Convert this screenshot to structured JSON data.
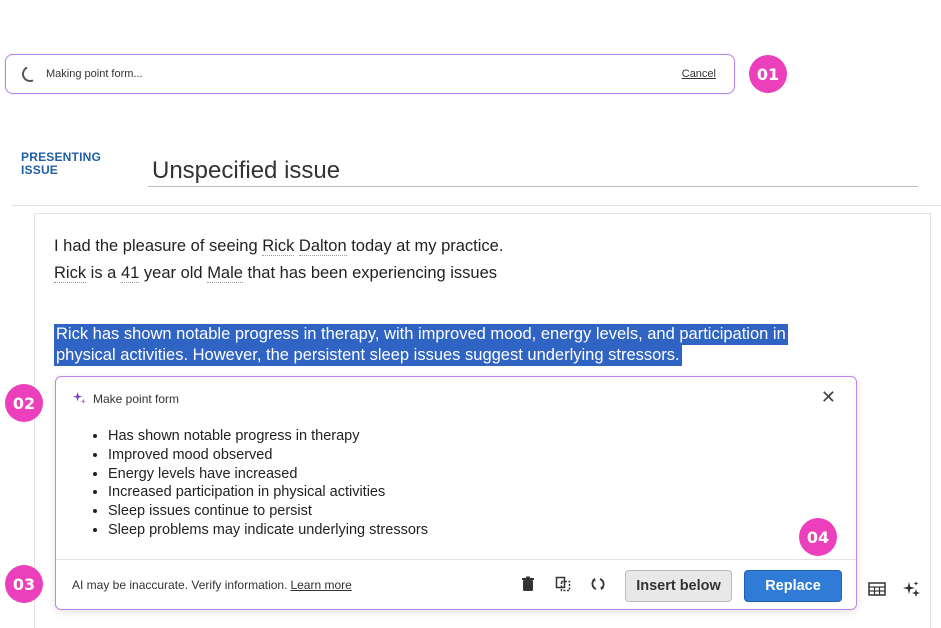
{
  "status_bar": {
    "text": "Making point form...",
    "cancel_label": "Cancel"
  },
  "steps": {
    "s1": "01",
    "s2": "02",
    "s3": "03",
    "s4": "04"
  },
  "presenting_issue": {
    "label": "PRESENTING\nISSUE",
    "value": "Unspecified issue"
  },
  "editor": {
    "line1": {
      "prefix": "I had the pleasure of seeing ",
      "first_name": "Rick",
      "last_name": "Dalton",
      "suffix": " today at my practice."
    },
    "line2": {
      "name": "Rick",
      "mid1": " is a ",
      "age": "41",
      "mid2": " year old ",
      "gender": "Male",
      "suffix": " that has been experiencing issues"
    },
    "selected_line1": "Rick has shown notable progress in therapy, with improved mood, energy levels, and participation in",
    "selected_line2": "physical activities. However, the persistent sleep issues suggest underlying stressors."
  },
  "popup": {
    "title": "Make point form",
    "bullets": [
      "Has shown notable progress in therapy",
      "Improved mood observed",
      "Energy levels have increased",
      "Increased participation in physical activities",
      "Sleep issues continue to persist",
      "Sleep problems may indicate underlying stressors"
    ],
    "disclaimer": "AI may be inaccurate. Verify information.",
    "learn_more": "Learn more",
    "insert_below_label": "Insert below",
    "replace_label": "Replace"
  },
  "colors": {
    "accent_pink": "#ec3fbb",
    "primary_blue": "#2f7bd6",
    "highlight": "#2f63c4",
    "popup_border": "#c185ea",
    "label_blue": "#1f5fa6"
  },
  "icons": [
    "spinner-icon",
    "sparkle-icon",
    "close-icon",
    "trash-icon",
    "copy-icon",
    "regenerate-icon",
    "table-icon",
    "ai-sparkle-icon"
  ]
}
